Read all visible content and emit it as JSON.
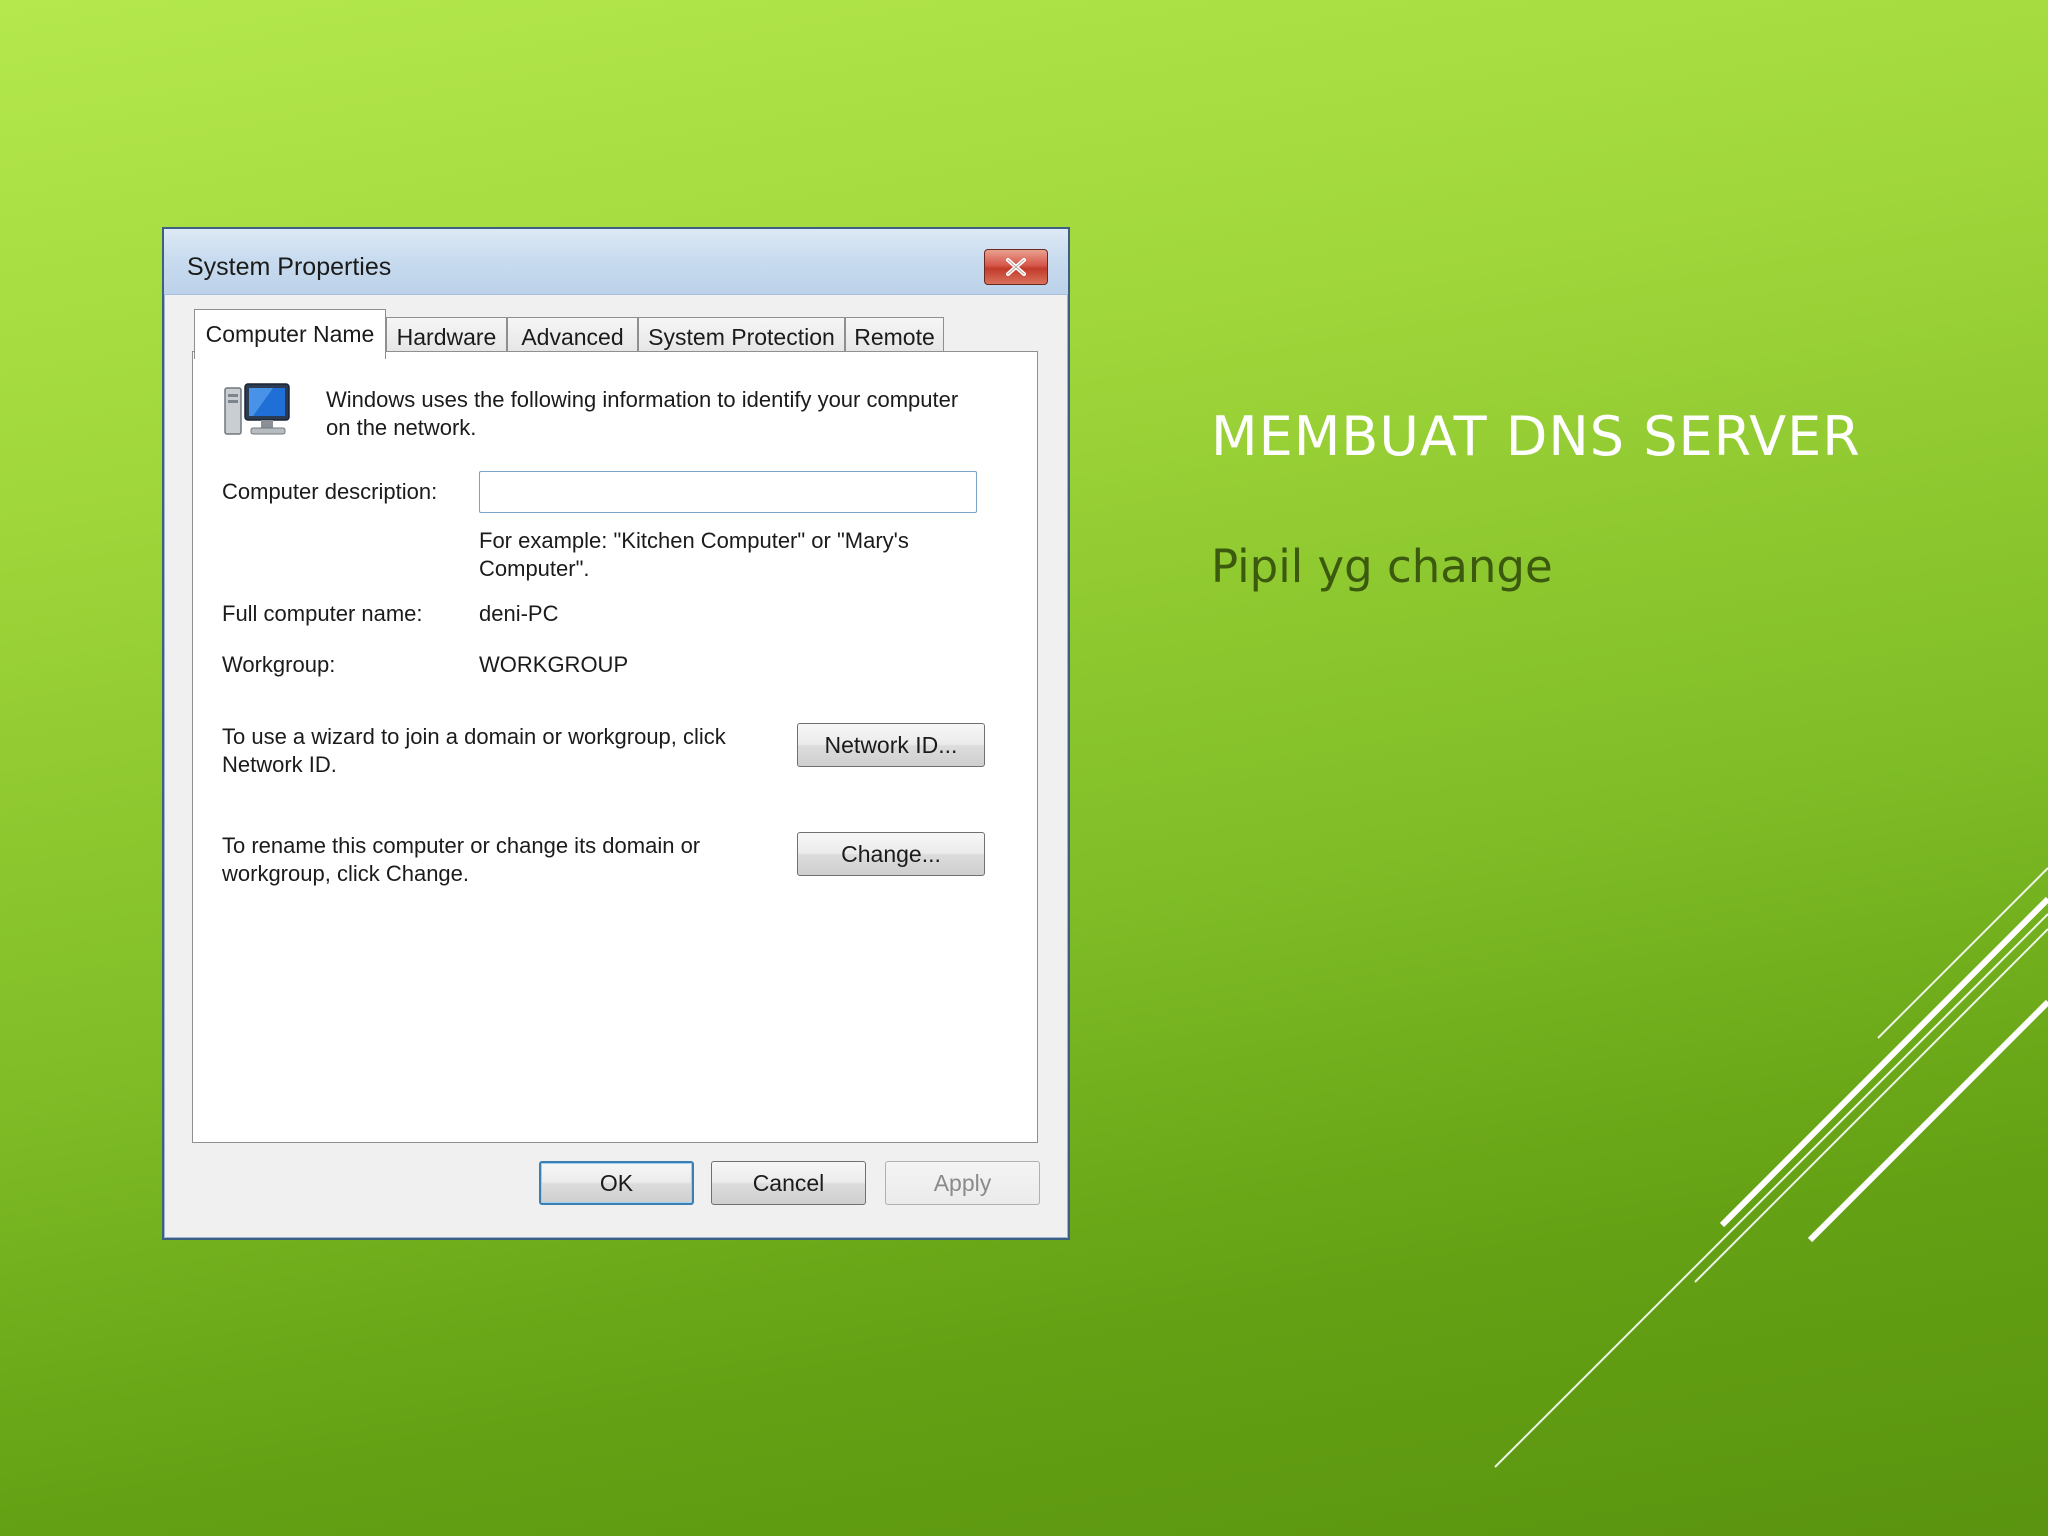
{
  "slide": {
    "title": "MEMBUAT DNS SERVER",
    "subtitle": "Pipil yg change"
  },
  "dialog": {
    "title": "System Properties",
    "close_icon": "close-x-icon",
    "tabs": [
      {
        "label": "Computer Name",
        "active": true
      },
      {
        "label": "Hardware",
        "active": false
      },
      {
        "label": "Advanced",
        "active": false
      },
      {
        "label": "System Protection",
        "active": false
      },
      {
        "label": "Remote",
        "active": false
      }
    ],
    "info_icon": "computer-monitor-icon",
    "info_text_line1": "Windows uses the following information to identify your computer",
    "info_text_line2": "on the network.",
    "description_label": "Computer description:",
    "description_value": "",
    "example_line1": "For example: \"Kitchen Computer\" or \"Mary's",
    "example_line2": "Computer\".",
    "full_name_label": "Full computer name:",
    "full_name_value": "deni-PC",
    "workgroup_label": "Workgroup:",
    "workgroup_value": "WORKGROUP",
    "network_id_text_line1": "To use a wizard to join a domain or workgroup, click",
    "network_id_text_line2": "Network ID.",
    "network_id_button": "Network ID...",
    "rename_text_line1": "To rename this computer or change its domain or",
    "rename_text_line2": "workgroup, click Change.",
    "change_button": "Change...",
    "ok_button": "OK",
    "cancel_button": "Cancel",
    "apply_button": "Apply"
  },
  "colors": {
    "background_top": "#b4e84c",
    "background_bottom": "#5a9410",
    "title_text": "#ffffff",
    "subtitle_text": "#3b5a0e"
  }
}
